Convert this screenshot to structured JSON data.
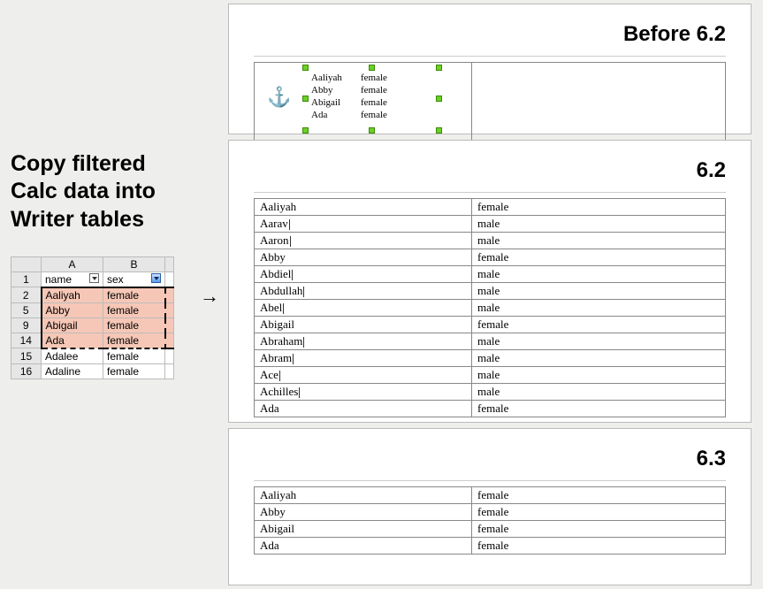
{
  "title": "Copy filtered Calc data into Writer tables",
  "arrow_glyph": "→",
  "anchor_glyph": "⚓",
  "calc": {
    "col_labels": {
      "A": "A",
      "B": "B"
    },
    "header_row": {
      "num": "1",
      "a": "name",
      "b": "sex"
    },
    "filtered_rows": [
      {
        "num": "2",
        "a": "Aaliyah",
        "b": "female",
        "highlighted": true
      },
      {
        "num": "5",
        "a": "Abby",
        "b": "female",
        "highlighted": true
      },
      {
        "num": "9",
        "a": "Abigail",
        "b": "female",
        "highlighted": true
      },
      {
        "num": "14",
        "a": "Ada",
        "b": "female",
        "highlighted": true
      },
      {
        "num": "15",
        "a": "Adalee",
        "b": "female",
        "highlighted": false
      },
      {
        "num": "16",
        "a": "Adaline",
        "b": "female",
        "highlighted": false
      }
    ]
  },
  "before": {
    "label": "Before 6.2",
    "embedded_rows": [
      {
        "a": "Aaliyah",
        "b": "female"
      },
      {
        "a": "Abby",
        "b": "female"
      },
      {
        "a": "Abigail",
        "b": "female"
      },
      {
        "a": "Ada",
        "b": "female"
      }
    ]
  },
  "v62": {
    "label": "6.2",
    "rows": [
      {
        "a": "Aaliyah",
        "b": "female"
      },
      {
        "a": "Aarav",
        "b": "male"
      },
      {
        "a": "Aaron",
        "b": "male"
      },
      {
        "a": "Abby",
        "b": "female"
      },
      {
        "a": "Abdiel",
        "b": "male"
      },
      {
        "a": "Abdullah",
        "b": "male"
      },
      {
        "a": "Abel",
        "b": "male"
      },
      {
        "a": "Abigail",
        "b": "female"
      },
      {
        "a": "Abraham",
        "b": "male"
      },
      {
        "a": "Abram",
        "b": "male"
      },
      {
        "a": "Ace",
        "b": "male"
      },
      {
        "a": "Achilles",
        "b": "male"
      },
      {
        "a": "Ada",
        "b": "female"
      }
    ]
  },
  "v63": {
    "label": "6.3",
    "rows": [
      {
        "a": "Aaliyah",
        "b": "female"
      },
      {
        "a": "Abby",
        "b": "female"
      },
      {
        "a": "Abigail",
        "b": "female"
      },
      {
        "a": "Ada",
        "b": "female"
      }
    ]
  }
}
